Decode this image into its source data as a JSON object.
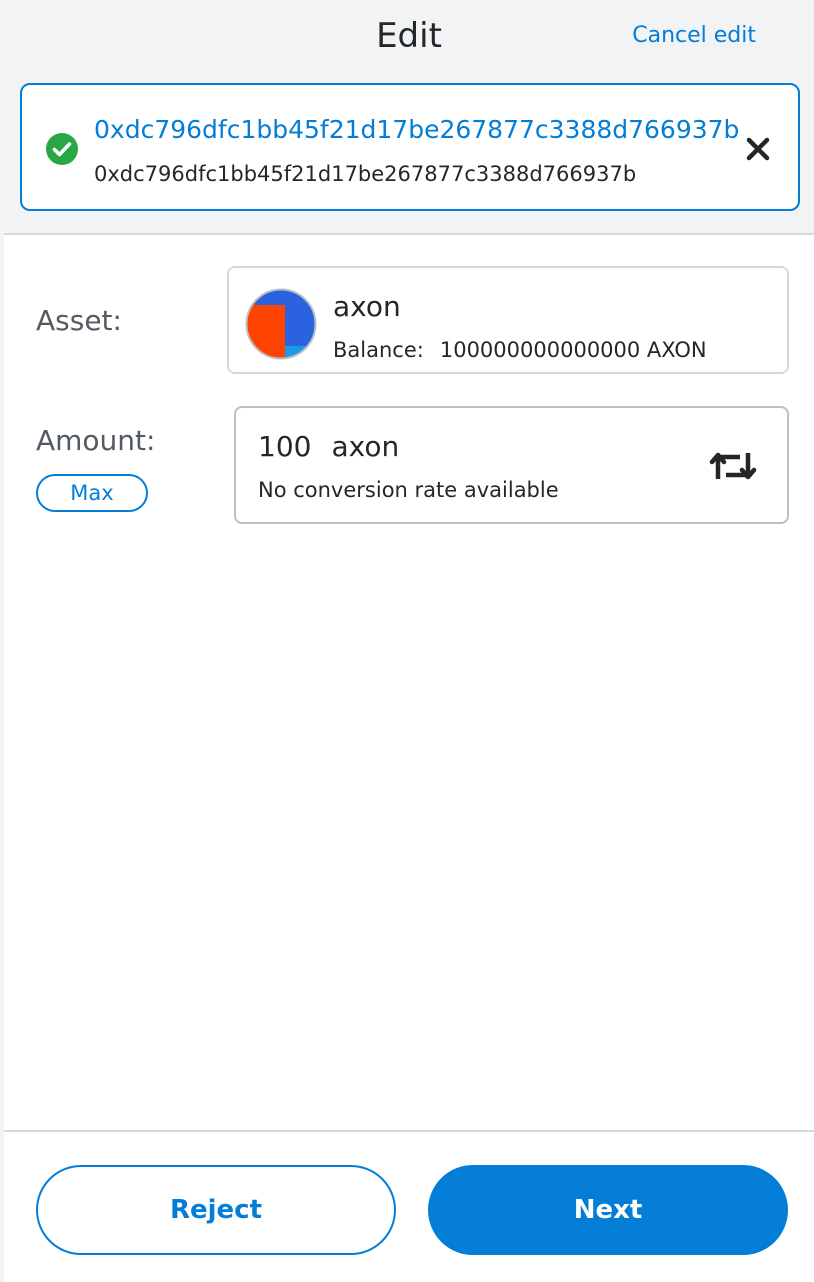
{
  "header": {
    "title": "Edit",
    "cancel_label": "Cancel edit"
  },
  "recipient": {
    "name": "0xdc796dfc1bb45f21d17be267877c3388d766937b",
    "address": "0xdc796dfc1bb45f21d17be267877c3388d766937b",
    "status_icon": "check-circle-icon",
    "clear_icon": "close-icon"
  },
  "asset": {
    "label": "Asset:",
    "name": "axon",
    "balance_label": "Balance:",
    "balance_value": "100000000000000 AXON",
    "avatar_colors": [
      "#2a62e0",
      "#ff4300",
      "#1f9be3"
    ]
  },
  "amount": {
    "label": "Amount:",
    "max_label": "Max",
    "value": "100",
    "unit": "axon",
    "conversion_text": "No conversion rate available",
    "swap_icon": "swap-arrows-icon"
  },
  "footer": {
    "reject_label": "Reject",
    "next_label": "Next"
  },
  "colors": {
    "accent": "#037dd6",
    "success": "#28a745",
    "text": "#24272a",
    "muted": "#535a61",
    "border": "#d6d9dc"
  }
}
